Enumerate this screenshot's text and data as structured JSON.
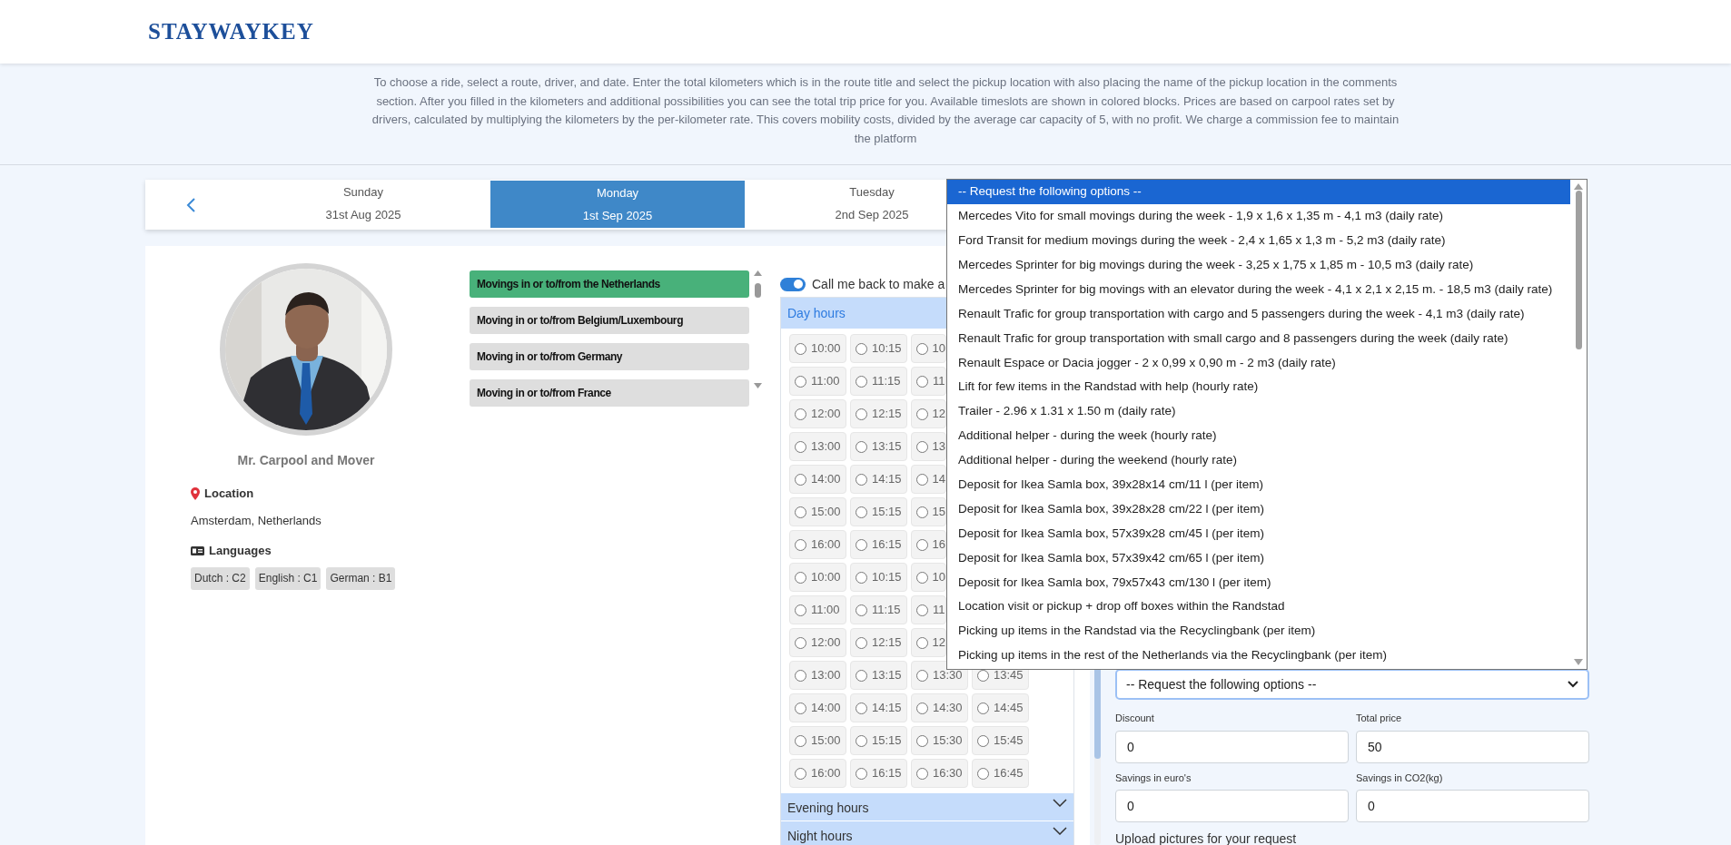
{
  "logo": "STAYWAYKEY",
  "intro": "To choose a ride, select a route, driver, and date. Enter the total kilometers which is in the route title and select the pickup location with also placing the name of the pickup location in the comments section. After you filled in the kilometers and additional possibilities you can see the total trip price for you. Available timeslots are shown in colored blocks. Prices are based on carpool rates set by drivers, calculated by multiplying the kilometers by the per-kilometer rate. This covers mobility costs, divided by the average car capacity of 5, with no profit. We charge a commission fee to maintain the platform",
  "days": [
    {
      "weekday": "Sunday",
      "date": "31st Aug 2025",
      "selected": false
    },
    {
      "weekday": "Monday",
      "date": "1st Sep 2025",
      "selected": true
    },
    {
      "weekday": "Tuesday",
      "date": "2nd Sep 2025",
      "selected": false
    }
  ],
  "profile": {
    "name": "Mr. Carpool and Mover",
    "location_label": "Location",
    "location": "Amsterdam, Netherlands",
    "languages_label": "Languages",
    "languages": [
      "Dutch : C2",
      "English : C1",
      "German : B1"
    ]
  },
  "routes": [
    {
      "label": "Movings in or to/from the Netherlands",
      "selected": true
    },
    {
      "label": "Moving in or to/from Belgium/Luxembourg",
      "selected": false
    },
    {
      "label": "Moving in or to/from Germany",
      "selected": false
    },
    {
      "label": "Moving in or to/from France",
      "selected": false
    }
  ],
  "callback": {
    "label": "Call me back to make a",
    "on": true
  },
  "time_sections": [
    {
      "title": "Day hours",
      "expanded": true,
      "rows": [
        [
          {
            "time": "10:00",
            "selected": false
          },
          {
            "time": "10:15",
            "selected": false
          },
          {
            "time": "10",
            "selected": false
          }
        ],
        [
          {
            "time": "11:00",
            "selected": false
          },
          {
            "time": "11:15",
            "selected": false
          },
          {
            "time": "11",
            "selected": false
          }
        ],
        [
          {
            "time": "12:00",
            "selected": false
          },
          {
            "time": "12:15",
            "selected": false
          },
          {
            "time": "12",
            "selected": false
          }
        ],
        [
          {
            "time": "13:00",
            "selected": false
          },
          {
            "time": "13:15",
            "selected": false
          },
          {
            "time": "13",
            "selected": false
          }
        ],
        [
          {
            "time": "14:00",
            "selected": false
          },
          {
            "time": "14:15",
            "selected": false
          },
          {
            "time": "14",
            "selected": false
          }
        ],
        [
          {
            "time": "15:00",
            "selected": false
          },
          {
            "time": "15:15",
            "selected": false
          },
          {
            "time": "15",
            "selected": false
          }
        ],
        [
          {
            "time": "16:00",
            "selected": false
          },
          {
            "time": "16:15",
            "selected": false
          },
          {
            "time": "16",
            "selected": false
          }
        ],
        [
          {
            "time": "10:00",
            "selected": false
          },
          {
            "time": "10:15",
            "selected": false
          },
          {
            "time": "10",
            "selected": false
          }
        ],
        [
          {
            "time": "11:00",
            "selected": false
          },
          {
            "time": "11:15",
            "selected": false
          },
          {
            "time": "11",
            "selected": false
          }
        ],
        [
          {
            "time": "12:00",
            "selected": false
          },
          {
            "time": "12:15",
            "selected": false
          },
          {
            "time": "12",
            "selected": false
          }
        ],
        [
          {
            "time": "13:00",
            "selected": false
          },
          {
            "time": "13:15",
            "selected": false
          },
          {
            "time": "13:30",
            "selected": false
          },
          {
            "time": "13:45",
            "selected": false
          }
        ],
        [
          {
            "time": "14:00",
            "selected": false
          },
          {
            "time": "14:15",
            "selected": false
          },
          {
            "time": "14:30",
            "selected": false
          },
          {
            "time": "14:45",
            "selected": false
          }
        ],
        [
          {
            "time": "15:00",
            "selected": false
          },
          {
            "time": "15:15",
            "selected": false
          },
          {
            "time": "15:30",
            "selected": false
          },
          {
            "time": "15:45",
            "selected": false
          }
        ],
        [
          {
            "time": "16:00",
            "selected": false
          },
          {
            "time": "16:15",
            "selected": false
          },
          {
            "time": "16:30",
            "selected": false
          },
          {
            "time": "16:45",
            "selected": false
          }
        ]
      ]
    },
    {
      "title": "Evening hours",
      "expanded": false
    },
    {
      "title": "Night hours",
      "expanded": false
    }
  ],
  "options_menu": [
    {
      "label": "-- Request the following options --",
      "selected": true
    },
    {
      "label": "Mercedes Vito for small movings during the week - 1,9 x 1,6 x 1,35 m - 4,1 m3 (daily rate)",
      "selected": false
    },
    {
      "label": "Ford Transit for medium movings during the week - 2,4 x 1,65 x 1,3 m - 5,2 m3 (daily rate)",
      "selected": false
    },
    {
      "label": "Mercedes Sprinter for big movings during the week - 3,25 x 1,75 x 1,85 m - 10,5 m3 (daily rate)",
      "selected": false
    },
    {
      "label": "Mercedes Sprinter for big movings with an elevator during the week - 4,1 x 2,1 x 2,15 m. - 18,5 m3 (daily rate)",
      "selected": false
    },
    {
      "label": "Renault Trafic for group transportation with cargo and 5 passengers during the week - 4,1 m3 (daily rate)",
      "selected": false
    },
    {
      "label": "Renault Trafic for group transportation with small cargo and 8 passengers during the week (daily rate)",
      "selected": false
    },
    {
      "label": "Renault Espace or Dacia jogger - 2 x 0,99 x 0,90 m - 2 m3 (daily rate)",
      "selected": false
    },
    {
      "label": "Lift for few items in the Randstad with help (hourly rate)",
      "selected": false
    },
    {
      "label": "Trailer - 2.96 x 1.31 x 1.50 m (daily rate)",
      "selected": false
    },
    {
      "label": "Additional helper - during the week (hourly rate)",
      "selected": false
    },
    {
      "label": "Additional helper - during the weekend (hourly rate)",
      "selected": false
    },
    {
      "label": "Deposit for Ikea Samla box, 39x28x14 cm/11 l (per item)",
      "selected": false
    },
    {
      "label": "Deposit for Ikea Samla box, 39x28x28 cm/22 l (per item)",
      "selected": false
    },
    {
      "label": "Deposit for Ikea Samla box, 57x39x28 cm/45 l (per item)",
      "selected": false
    },
    {
      "label": "Deposit for Ikea Samla box, 57x39x42 cm/65 l (per item)",
      "selected": false
    },
    {
      "label": "Deposit for Ikea Samla box, 79x57x43 cm/130 l (per item)",
      "selected": false
    },
    {
      "label": "Location visit or pickup + drop off boxes within the Randstad",
      "selected": false
    },
    {
      "label": "Picking up items in the Randstad via the Recyclingbank (per item)",
      "selected": false
    },
    {
      "label": "Picking up items in the rest of the Netherlands via the Recyclingbank (per item)",
      "selected": false
    }
  ],
  "options_select": {
    "value": "-- Request the following options --"
  },
  "fields": [
    {
      "label": "Discount",
      "value": "0"
    },
    {
      "label": "Total price",
      "value": "50"
    },
    {
      "label": "Savings in euro's",
      "value": "0"
    },
    {
      "label": "Savings in CO2(kg)",
      "value": "0"
    }
  ],
  "upload_label": "Upload pictures for your request"
}
